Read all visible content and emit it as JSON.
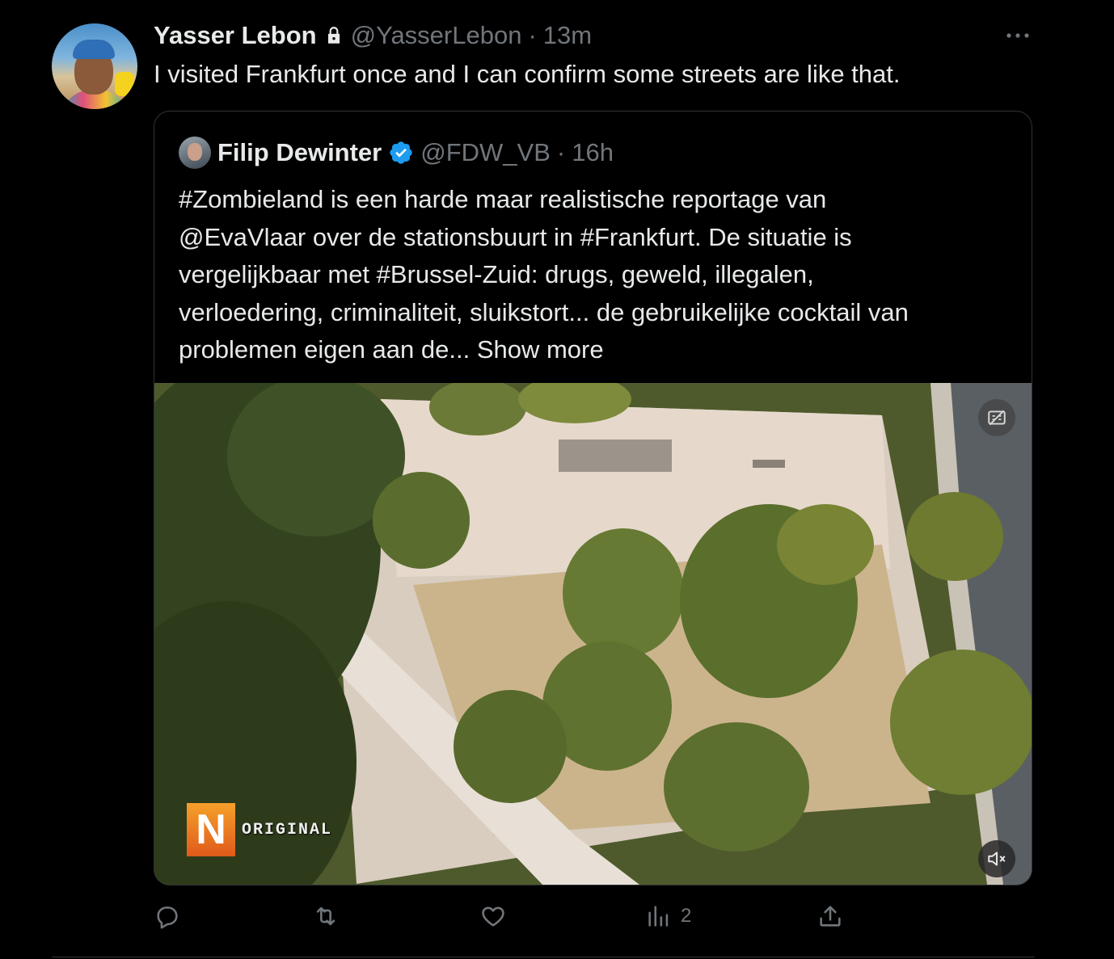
{
  "tweet": {
    "author_name": "Yasser Lebon",
    "author_handle": "@YasserLebon",
    "separator": "·",
    "time": "13m",
    "text": "I visited Frankfurt once and I can confirm some streets are like that.",
    "protected_icon": "lock-icon",
    "more_icon": "more-horizontal-icon"
  },
  "quote": {
    "author_name": "Filip Dewinter",
    "author_handle": "@FDW_VB",
    "separator": "·",
    "time": "16h",
    "verified_icon": "verified-badge-icon",
    "text_lines": [
      "#Zombieland is een harde maar realistische reportage van",
      "@EvaVlaar over de stationsbuurt in #Frankfurt. De situatie is",
      "vergelijkbaar met #Brussel-Zuid: drugs, geweld, illegalen,",
      "verloedering, criminaliteit, sluikstort... de gebruikelijke cocktail van",
      "problemen eigen aan de... "
    ],
    "show_more": "Show more",
    "video": {
      "watermark_letter": "N",
      "watermark_text": "ORIGINAL",
      "captions_icon": "captions-off-icon",
      "mute_icon": "volume-muted-icon"
    }
  },
  "actions": {
    "reply_icon": "reply-icon",
    "retweet_icon": "retweet-icon",
    "like_icon": "like-heart-icon",
    "views_icon": "views-bar-chart-icon",
    "views_count": "2",
    "share_icon": "share-upload-icon"
  },
  "colors": {
    "background": "#000000",
    "text_primary": "#e7e9ea",
    "text_secondary": "#71767b",
    "border": "#2f3336",
    "verified_blue": "#1d9bf0"
  }
}
